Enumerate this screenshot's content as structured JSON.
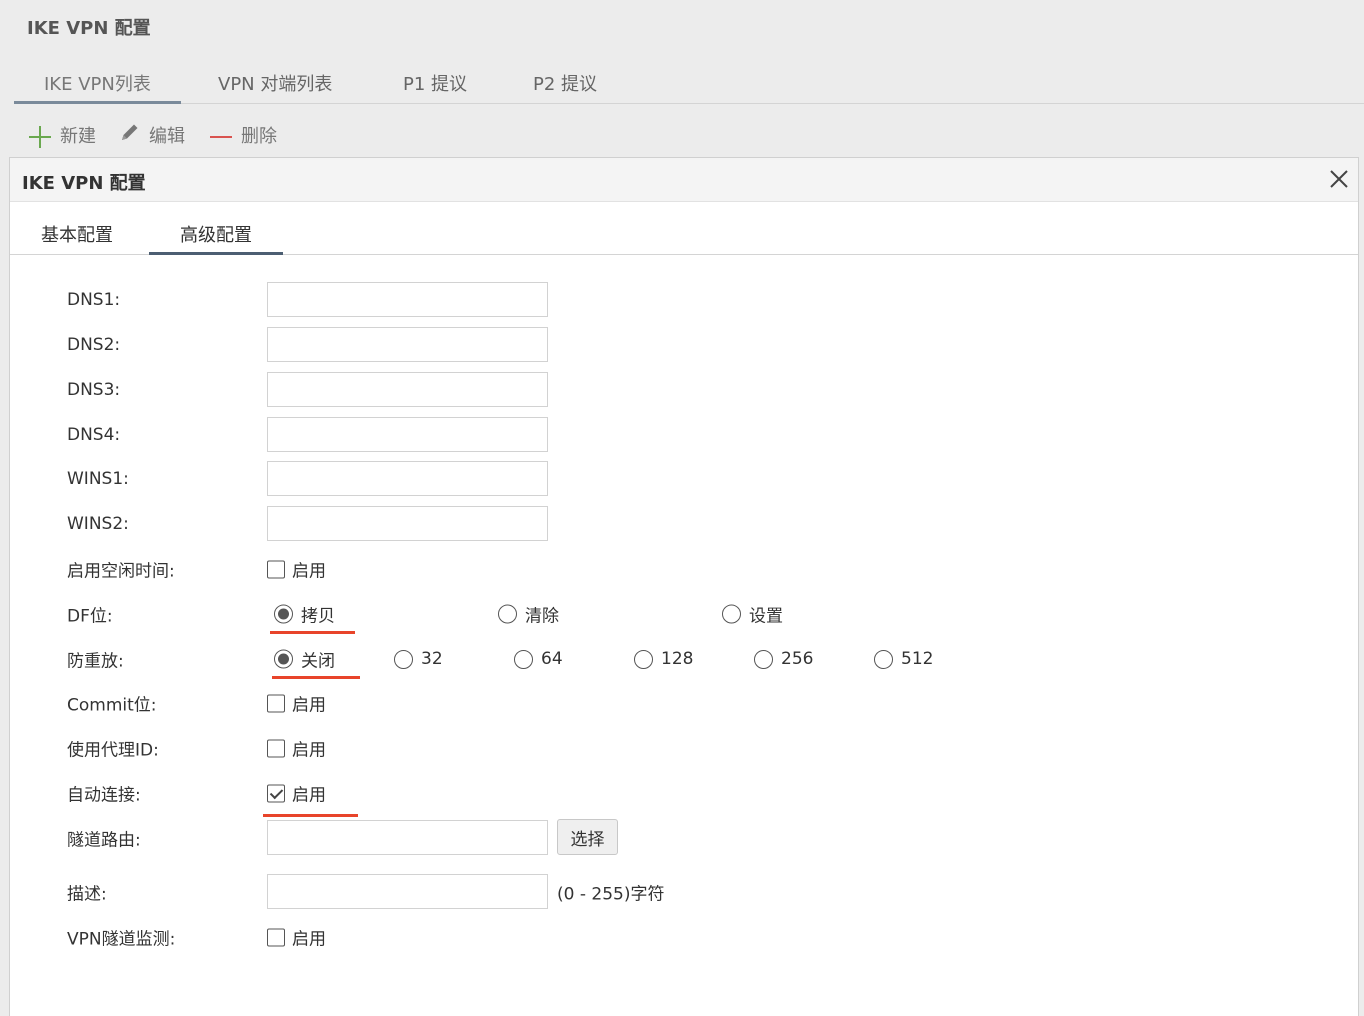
{
  "page": {
    "title": "IKE VPN 配置",
    "tabs": [
      "IKE VPN列表",
      "VPN 对端列表",
      "P1 提议",
      "P2 提议"
    ],
    "toolbar": {
      "new_label": "新建",
      "edit_label": "编辑",
      "delete_label": "删除"
    }
  },
  "dialog": {
    "title": "IKE VPN 配置",
    "tabs": [
      "基本配置",
      "高级配置"
    ],
    "active_tab": "高级配置"
  },
  "form": {
    "dns1": {
      "label": "DNS1:",
      "value": ""
    },
    "dns2": {
      "label": "DNS2:",
      "value": ""
    },
    "dns3": {
      "label": "DNS3:",
      "value": ""
    },
    "dns4": {
      "label": "DNS4:",
      "value": ""
    },
    "wins1": {
      "label": "WINS1:",
      "value": ""
    },
    "wins2": {
      "label": "WINS2:",
      "value": ""
    },
    "idle_time": {
      "label": "启用空闲时间:",
      "option": "启用",
      "checked": false
    },
    "df_bit": {
      "label": "DF位:",
      "options": [
        "拷贝",
        "清除",
        "设置"
      ],
      "selected": "拷贝"
    },
    "anti_replay": {
      "label": "防重放:",
      "options": [
        "关闭",
        "32",
        "64",
        "128",
        "256",
        "512"
      ],
      "selected": "关闭"
    },
    "commit_bit": {
      "label": "Commit位:",
      "option": "启用",
      "checked": false
    },
    "proxy_id": {
      "label": "使用代理ID:",
      "option": "启用",
      "checked": false
    },
    "auto_connect": {
      "label": "自动连接:",
      "option": "启用",
      "checked": true
    },
    "tunnel_route": {
      "label": "隧道路由:",
      "value": "",
      "button": "选择"
    },
    "description": {
      "label": "描述:",
      "value": "",
      "hint": "(0 - 255)字符"
    },
    "tunnel_monitor": {
      "label": "VPN隧道监测:",
      "option": "启用",
      "checked": false
    }
  },
  "colors": {
    "highlight": "#e8442a",
    "tab_active": "#4c5e72",
    "add": "#6aa84f",
    "delete": "#d9534f"
  }
}
